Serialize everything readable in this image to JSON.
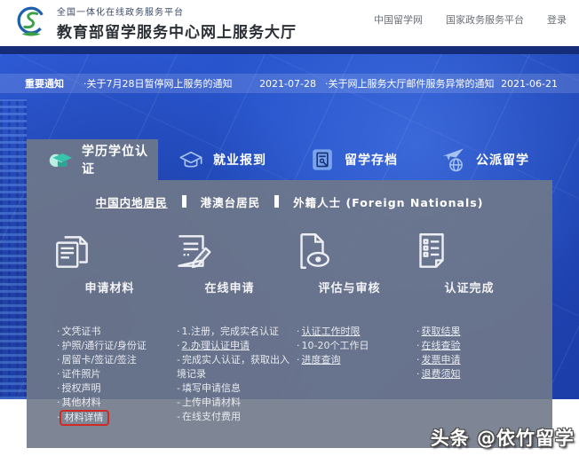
{
  "header": {
    "platform_label": "全国一体化在线政务服务平台",
    "site_title": "教育部留学服务中心网上服务大厅",
    "links": [
      {
        "label": "中国留学网"
      },
      {
        "label": "国家政务服务平台"
      },
      {
        "label": "登录"
      }
    ]
  },
  "notice_bar": {
    "label": "重要通知",
    "notices": [
      {
        "title": "·关于7月28日暂停网上服务的通知",
        "date": "2021-07-28"
      },
      {
        "title": "·关于网上服务大厅邮件服务异常的通知",
        "date": "2021-06-21"
      }
    ]
  },
  "tabs": [
    {
      "label": "学历学位认证",
      "icon": "graduation-cap-filled-icon",
      "active": true
    },
    {
      "label": "就业报到",
      "icon": "graduation-cap-outline-icon",
      "active": false
    },
    {
      "label": "留学存档",
      "icon": "archive-document-icon",
      "active": false
    },
    {
      "label": "公派留学",
      "icon": "airplane-globe-icon",
      "active": false
    }
  ],
  "audience_nav": [
    {
      "label": "中国内地居民",
      "active": true
    },
    {
      "label": "港澳台居民",
      "active": false
    },
    {
      "label": "外籍人士 (Foreign Nationals)",
      "active": false
    }
  ],
  "steps": [
    {
      "title": "申请材料",
      "icon": "documents-icon",
      "items": [
        {
          "prefix": "·",
          "text": "文凭证书"
        },
        {
          "prefix": "·",
          "text": "护照/通行证/身份证"
        },
        {
          "prefix": "·",
          "text": "居留卡/签证/签注"
        },
        {
          "prefix": "·",
          "text": "证件照片"
        },
        {
          "prefix": "·",
          "text": "授权声明"
        },
        {
          "prefix": "·",
          "text": "其他材料"
        },
        {
          "prefix": "·",
          "text": "材料详情",
          "highlighted": true
        }
      ]
    },
    {
      "title": "在线申请",
      "icon": "edit-document-icon",
      "items": [
        {
          "prefix": "·",
          "text": "1.注册，完成实名认证"
        },
        {
          "prefix": "·",
          "text": "2.办理认证申请",
          "underline": true
        },
        {
          "prefix": "-",
          "text": "完成实人认证，获取出入境记录"
        },
        {
          "prefix": "-",
          "text": "填写申请信息"
        },
        {
          "prefix": "-",
          "text": "上传申请材料"
        },
        {
          "prefix": "-",
          "text": "在线支付费用"
        }
      ]
    },
    {
      "title": "评估与审核",
      "icon": "review-eye-document-icon",
      "items": [
        {
          "prefix": "·",
          "text": "认证工作时限",
          "underline": true
        },
        {
          "prefix": "·",
          "text": "10-20个工作日"
        },
        {
          "prefix": "·",
          "text": "进度查询",
          "underline": true
        }
      ]
    },
    {
      "title": "认证完成",
      "icon": "checklist-document-icon",
      "items": [
        {
          "prefix": "·",
          "text": "获取结果",
          "underline": true
        },
        {
          "prefix": "·",
          "text": "在线查验",
          "underline": true
        },
        {
          "prefix": "·",
          "text": "发票申请",
          "underline": true
        },
        {
          "prefix": "·",
          "text": "退费须知",
          "underline": true
        }
      ]
    }
  ],
  "watermark": "头条 @依竹留学",
  "colors": {
    "banner_blue": "#2450c6",
    "panel_gray": "#707888",
    "accent_teal": "#38c3ad",
    "highlight_red": "#cf2a24",
    "link_light": "#e7eaf0"
  }
}
